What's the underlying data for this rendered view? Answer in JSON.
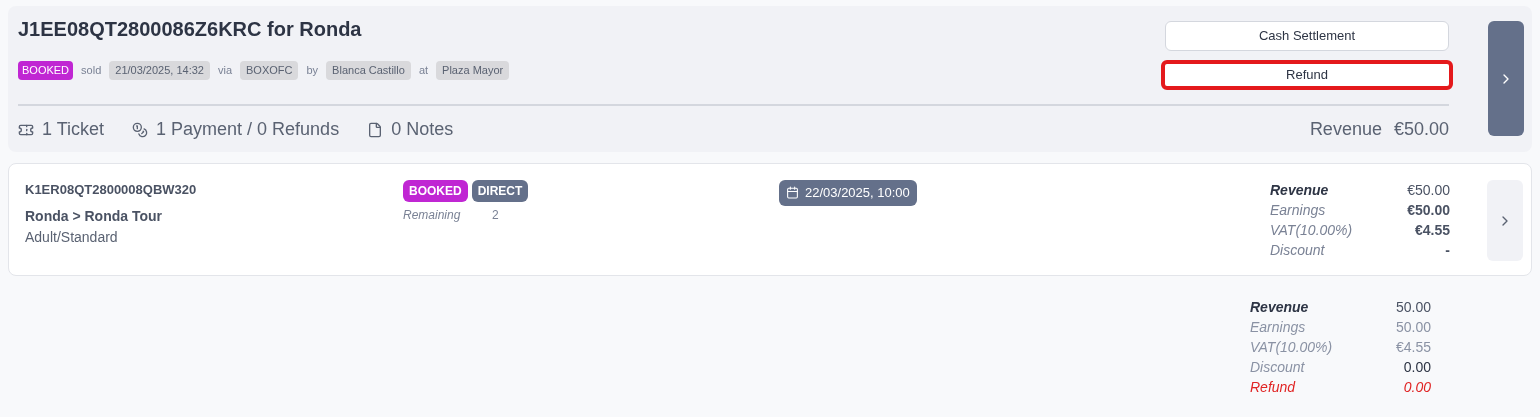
{
  "order": {
    "title": "J1EE08QT2800086Z6KRC for Ronda",
    "meta": [
      {
        "kind": "badge",
        "text": "BOOKED",
        "color": "#c026d3"
      },
      {
        "kind": "word",
        "text": "sold"
      },
      {
        "kind": "chip",
        "text": "21/03/2025, 14:32"
      },
      {
        "kind": "word",
        "text": "via"
      },
      {
        "kind": "chip",
        "text": "BOXOFC"
      },
      {
        "kind": "word",
        "text": "by"
      },
      {
        "kind": "chip",
        "text": "Blanca Castillo"
      },
      {
        "kind": "word",
        "text": "at"
      },
      {
        "kind": "chip",
        "text": "Plaza Mayor"
      }
    ],
    "actions": [
      {
        "label": "Cash Settlement",
        "highlighted": false
      },
      {
        "label": "Refund",
        "highlighted": true
      }
    ],
    "stats": [
      {
        "kind": "ticket",
        "text": "1 Ticket"
      },
      {
        "kind": "payment",
        "text": "1 Payment / 0 Refunds"
      },
      {
        "kind": "note",
        "text": "0 Notes"
      }
    ],
    "revenue_label": "Revenue",
    "revenue_value": "€50.00"
  },
  "tickets": [
    {
      "code": "K1ER08QT2800008QBW320",
      "product": "Ronda > Ronda Tour",
      "type": "Adult/Standard",
      "badges": [
        {
          "text": "BOOKED",
          "color": "#c026d3"
        },
        {
          "text": "DIRECT",
          "color": "#64708a"
        }
      ],
      "remaining_label": "Remaining",
      "remaining_value": "2",
      "date": "22/03/2025, 10:00",
      "amounts": [
        {
          "kind": "total",
          "label": "Revenue",
          "value": "€50.00"
        },
        {
          "kind": "mixed",
          "label": "Earnings",
          "value": "€50.00"
        },
        {
          "kind": "mixed",
          "label": "VAT(10.00%)",
          "value": "€4.55"
        },
        {
          "kind": "mixed",
          "label": "Discount",
          "value": "-"
        }
      ]
    }
  ],
  "summary": [
    {
      "kind": "total",
      "label": "Revenue",
      "value": "50.00"
    },
    {
      "kind": "muted",
      "label": "Earnings",
      "value": "50.00"
    },
    {
      "kind": "muted",
      "label": "VAT(10.00%)",
      "value": "€4.55"
    },
    {
      "kind": "plain",
      "label": "Discount",
      "value": "0.00"
    },
    {
      "kind": "refund",
      "label": "Refund",
      "value": "0.00"
    }
  ]
}
